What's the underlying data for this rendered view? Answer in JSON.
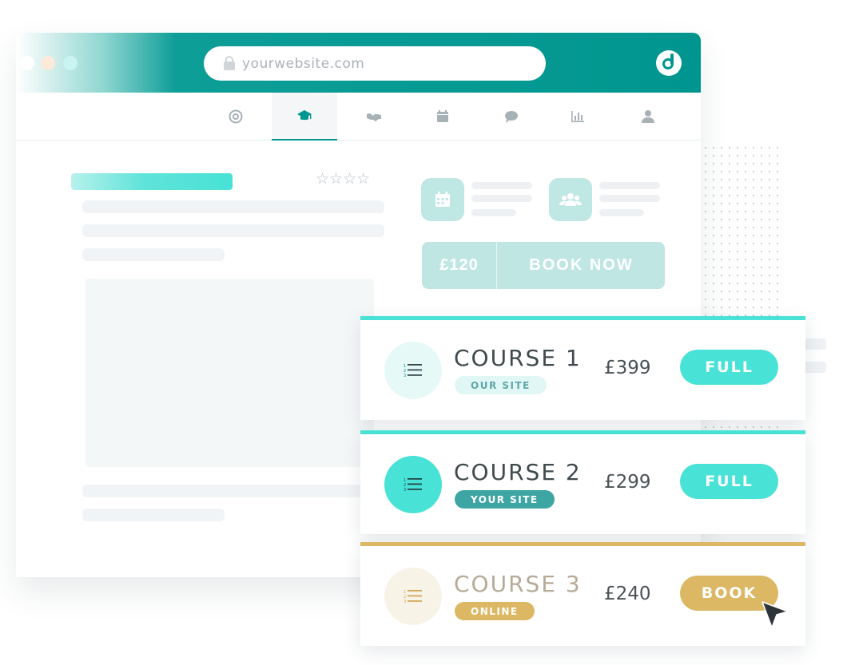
{
  "browser": {
    "url": "yourwebsite.com",
    "window_dots": [
      "#ffffff",
      "#fde9d9",
      "#c9f4f1"
    ],
    "accent": "#00968f",
    "nav_icons": [
      "target-icon",
      "graduation-cap-icon",
      "handshake-icon",
      "calendar-icon",
      "chat-bubble-icon",
      "bar-chart-icon",
      "user-icon"
    ],
    "active_tab": "graduation-cap-icon"
  },
  "page": {
    "rating_stars": "☆☆☆☆",
    "booking": {
      "price": "£120",
      "button": "BOOK NOW"
    }
  },
  "courses": [
    {
      "title": "COURSE 1",
      "badge": "OUR SITE",
      "price": "£399",
      "action": "FULL",
      "color": "#48e2d6"
    },
    {
      "title": "COURSE 2",
      "badge": "YOUR SITE",
      "price": "£299",
      "action": "FULL",
      "color": "#48e2d6"
    },
    {
      "title": "COURSE 3",
      "badge": "ONLINE",
      "price": "£240",
      "action": "BOOK",
      "color": "#dcb865"
    }
  ]
}
